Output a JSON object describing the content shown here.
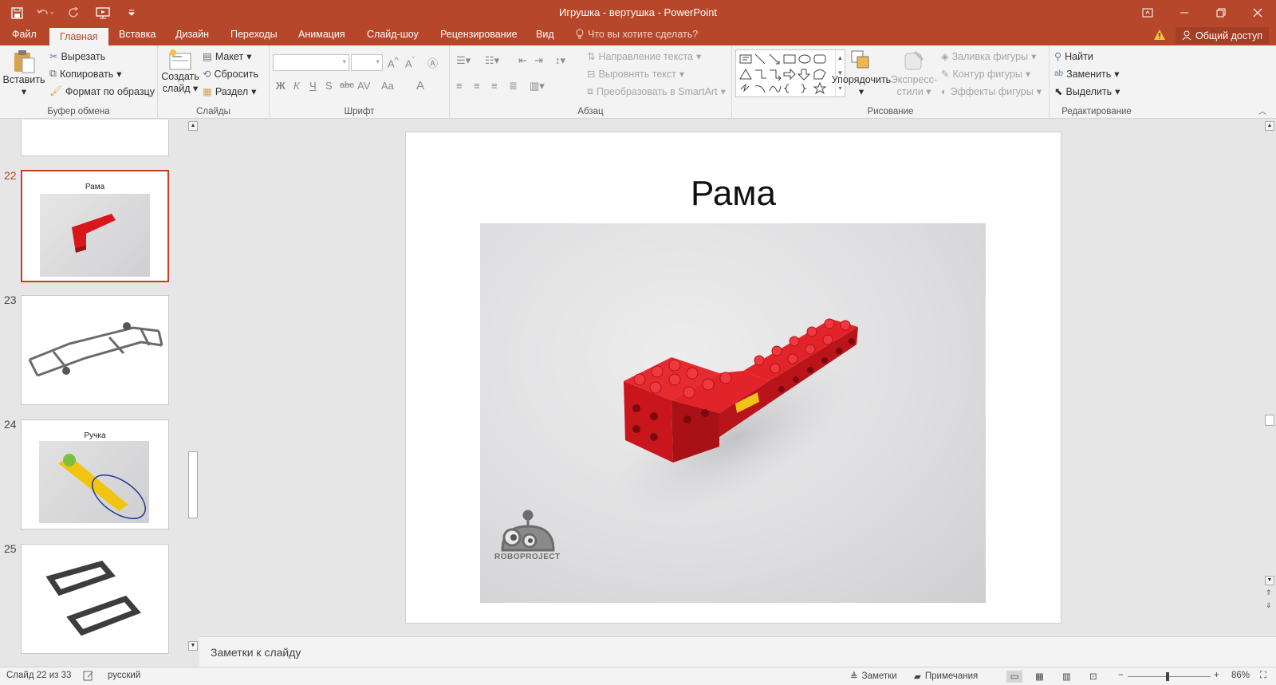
{
  "window": {
    "title": "Игрушка - вертушка - PowerPoint"
  },
  "tabs": [
    "Файл",
    "Главная",
    "Вставка",
    "Дизайн",
    "Переходы",
    "Анимация",
    "Слайд-шоу",
    "Рецензирование",
    "Вид"
  ],
  "active_tab": "Главная",
  "tell_me": "Что вы хотите сделать?",
  "share": "Общий доступ",
  "ribbon": {
    "clipboard": {
      "label": "Буфер обмена",
      "paste": "Вставить",
      "cut": "Вырезать",
      "copy": "Копировать",
      "format_painter": "Формат по образцу"
    },
    "slides": {
      "label": "Слайды",
      "new_slide_1": "Создать",
      "new_slide_2": "слайд",
      "layout": "Макет",
      "reset": "Сбросить",
      "section": "Раздел"
    },
    "font": {
      "label": "Шрифт",
      "bold": "Ж",
      "italic": "К",
      "underline": "Ч",
      "shadow": "S",
      "strike": "abc",
      "spacing": "AV",
      "case": "Aa",
      "color": "A"
    },
    "paragraph": {
      "label": "Абзац",
      "text_direction": "Направление текста",
      "align_text": "Выровнять текст",
      "smartart": "Преобразовать в SmartArt"
    },
    "drawing": {
      "label": "Рисование",
      "arrange": "Упорядочить",
      "quick_styles_1": "Экспресс-",
      "quick_styles_2": "стили",
      "shape_fill": "Заливка фигуры",
      "shape_outline": "Контур фигуры",
      "shape_effects": "Эффекты фигуры"
    },
    "editing": {
      "label": "Редактирование",
      "find": "Найти",
      "replace": "Заменить",
      "select": "Выделить"
    }
  },
  "thumbnails": [
    {
      "num": "22",
      "title": "Рама",
      "selected": true
    },
    {
      "num": "23",
      "title": "",
      "selected": false
    },
    {
      "num": "24",
      "title": "Ручка",
      "selected": false
    },
    {
      "num": "25",
      "title": "",
      "selected": false
    }
  ],
  "slide": {
    "title": "Рама",
    "logo_text": "ROBOPROJECT"
  },
  "notes_placeholder": "Заметки к слайду",
  "status": {
    "slide_info": "Слайд 22 из 33",
    "language": "русский",
    "notes": "Заметки",
    "comments": "Примечания",
    "zoom": "86%"
  },
  "colors": {
    "accent": "#b7472a",
    "lego_red": "#d9161c",
    "selection": "#c43e1c"
  }
}
